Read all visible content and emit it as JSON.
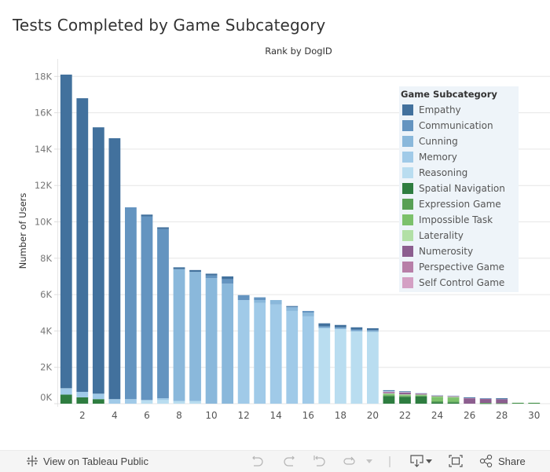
{
  "page": {
    "title": "Tests Completed by Game Subcategory"
  },
  "chart_data": {
    "type": "bar",
    "stacked": true,
    "title": "Tests Completed by Game Subcategory",
    "column_header": "Rank by DogID",
    "xlabel": "",
    "ylabel": "Number of Users",
    "ylim": [
      0,
      19000
    ],
    "y_ticks": [
      0,
      2000,
      4000,
      6000,
      8000,
      10000,
      12000,
      14000,
      16000,
      18000
    ],
    "y_tick_labels": [
      "0K",
      "2K",
      "4K",
      "6K",
      "8K",
      "10K",
      "12K",
      "14K",
      "16K",
      "18K"
    ],
    "x": [
      1,
      2,
      3,
      4,
      5,
      6,
      7,
      8,
      9,
      10,
      11,
      12,
      13,
      14,
      15,
      16,
      17,
      18,
      19,
      20,
      21,
      22,
      23,
      24,
      25,
      26,
      27,
      28,
      29,
      30
    ],
    "x_tick_labels": [
      "2",
      "4",
      "6",
      "8",
      "10",
      "12",
      "14",
      "16",
      "18",
      "20",
      "22",
      "24",
      "26",
      "28",
      "30"
    ],
    "x_tick_values": [
      2,
      4,
      6,
      8,
      10,
      12,
      14,
      16,
      18,
      20,
      22,
      24,
      26,
      28,
      30
    ],
    "grid": true,
    "legend_title": "Game Subcategory",
    "legend_position": "right",
    "series": [
      {
        "name": "Spatial Navigation",
        "color": "#2e7d40",
        "values": [
          500,
          350,
          250,
          0,
          0,
          0,
          0,
          0,
          0,
          0,
          0,
          0,
          0,
          0,
          0,
          0,
          0,
          0,
          0,
          0,
          420,
          380,
          400,
          80,
          60,
          0,
          20,
          0,
          40,
          40
        ]
      },
      {
        "name": "Expression Game",
        "color": "#58a055",
        "values": [
          0,
          0,
          0,
          0,
          0,
          0,
          0,
          0,
          0,
          0,
          0,
          0,
          0,
          0,
          0,
          0,
          0,
          0,
          0,
          0,
          40,
          40,
          30,
          50,
          50,
          0,
          20,
          20,
          10,
          10
        ]
      },
      {
        "name": "Impossible Task",
        "color": "#7cc16b",
        "values": [
          0,
          0,
          0,
          0,
          0,
          0,
          0,
          0,
          0,
          0,
          0,
          0,
          0,
          0,
          0,
          0,
          0,
          0,
          0,
          0,
          60,
          50,
          40,
          240,
          230,
          0,
          0,
          0,
          0,
          0
        ]
      },
      {
        "name": "Laterality",
        "color": "#b2e0a6",
        "values": [
          0,
          0,
          0,
          0,
          0,
          0,
          0,
          0,
          0,
          0,
          0,
          0,
          0,
          0,
          0,
          0,
          0,
          0,
          0,
          0,
          50,
          40,
          30,
          40,
          40,
          0,
          0,
          0,
          0,
          0
        ]
      },
      {
        "name": "Numerosity",
        "color": "#8c5e8f",
        "values": [
          0,
          0,
          0,
          0,
          0,
          0,
          0,
          0,
          0,
          0,
          0,
          0,
          0,
          0,
          0,
          0,
          0,
          0,
          0,
          0,
          60,
          100,
          60,
          30,
          30,
          290,
          230,
          230,
          0,
          0
        ]
      },
      {
        "name": "Perspective Game",
        "color": "#b77fa8",
        "values": [
          0,
          0,
          0,
          0,
          0,
          0,
          0,
          0,
          0,
          0,
          0,
          0,
          0,
          0,
          0,
          0,
          0,
          0,
          0,
          0,
          20,
          20,
          10,
          20,
          20,
          20,
          10,
          10,
          0,
          0
        ]
      },
      {
        "name": "Self Control Game",
        "color": "#d4a0c4",
        "values": [
          0,
          0,
          0,
          0,
          0,
          0,
          0,
          0,
          0,
          0,
          0,
          0,
          0,
          0,
          0,
          0,
          0,
          0,
          0,
          0,
          10,
          10,
          10,
          10,
          10,
          10,
          0,
          0,
          0,
          0
        ]
      },
      {
        "name": "Reasoning",
        "color": "#b9ddf0",
        "values": [
          0,
          0,
          0,
          0,
          0,
          200,
          200,
          150,
          150,
          0,
          0,
          0,
          0,
          0,
          0,
          0,
          4150,
          4100,
          3970,
          3950,
          40,
          20,
          20,
          10,
          10,
          0,
          0,
          0,
          0,
          0
        ]
      },
      {
        "name": "Memory",
        "color": "#a0cae8",
        "values": [
          350,
          300,
          300,
          250,
          250,
          0,
          100,
          0,
          0,
          0,
          0,
          5700,
          5550,
          5450,
          5100,
          4800,
          0,
          0,
          0,
          0,
          0,
          0,
          0,
          0,
          0,
          0,
          0,
          0,
          0,
          0
        ]
      },
      {
        "name": "Cunning",
        "color": "#8ab8db",
        "values": [
          0,
          0,
          0,
          0,
          0,
          0,
          0,
          7250,
          7100,
          6900,
          6600,
          0,
          150,
          250,
          200,
          200,
          60,
          60,
          60,
          50,
          0,
          0,
          0,
          0,
          0,
          0,
          0,
          0,
          0,
          0
        ]
      },
      {
        "name": "Communication",
        "color": "#6494c0",
        "values": [
          0,
          0,
          0,
          0,
          10550,
          10100,
          9300,
          0,
          0,
          150,
          250,
          270,
          150,
          0,
          50,
          100,
          50,
          50,
          50,
          50,
          20,
          0,
          0,
          0,
          0,
          20,
          20,
          20,
          0,
          0
        ]
      },
      {
        "name": "Empathy",
        "color": "#42719d",
        "values": [
          17250,
          16150,
          14650,
          14350,
          0,
          100,
          100,
          100,
          100,
          100,
          150,
          0,
          0,
          0,
          20,
          0,
          160,
          120,
          120,
          100,
          20,
          20,
          0,
          0,
          0,
          10,
          0,
          20,
          0,
          0
        ]
      }
    ],
    "legend_order": [
      "Empathy",
      "Communication",
      "Cunning",
      "Memory",
      "Reasoning",
      "Spatial Navigation",
      "Expression Game",
      "Impossible Task",
      "Laterality",
      "Numerosity",
      "Perspective Game",
      "Self Control Game"
    ]
  },
  "toolbar": {
    "view_on_label": "View on Tableau Public",
    "share_label": "Share",
    "icons": [
      "tableau-logo-icon",
      "undo-icon",
      "redo-icon",
      "revert-icon",
      "refresh-icon",
      "pause-dropdown-icon",
      "download-icon",
      "fullscreen-icon",
      "share-icon"
    ]
  }
}
